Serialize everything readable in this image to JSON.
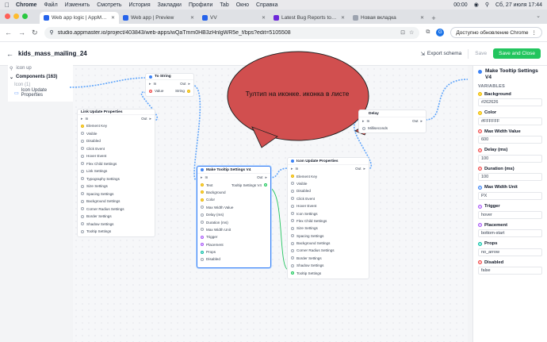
{
  "menubar": {
    "app": "Chrome",
    "items": [
      "Файл",
      "Изменить",
      "Смотреть",
      "История",
      "Закладки",
      "Профили",
      "Tab",
      "Окно",
      "Справка"
    ],
    "time_counter": "00:00",
    "datetime": "Сб, 27 июля 17:44"
  },
  "tabs": [
    {
      "label": "Web app logic | AppMaster",
      "color": "#2563eb"
    },
    {
      "label": "Web app | Preview",
      "color": "#2563eb"
    },
    {
      "label": "VV",
      "color": "#2563eb"
    },
    {
      "label": "Latest Bug Reports topics - A",
      "color": "#6d28d9"
    },
    {
      "label": "Новая вкладка",
      "color": "#9ca3af"
    }
  ],
  "addressbar": {
    "url": "studio.appmaster.io/project/403843/web-apps/wQaTmm0HB3zHnlgWR5e_f/bps?edit=5105508",
    "profile_letter": "G",
    "update_label": "Доступно обновление Chrome"
  },
  "header": {
    "title": "kids_mass_mailing_24",
    "export_label": "Export schema",
    "save_label": "Save",
    "save_close_label": "Save and Close"
  },
  "leftpanel": {
    "search_value": "icon up",
    "components_label": "Components (163)",
    "icon_count": "Icon (1)",
    "item_label": "Icon Update Properties"
  },
  "nodes": {
    "to_string": {
      "title": "To String",
      "in": "In",
      "out": "Out",
      "value": "Value",
      "string": "String"
    },
    "link_update": {
      "title": "Link Update Properties",
      "in": "In",
      "out": "Out",
      "rows": [
        "Element Key",
        "Visible",
        "Disabled",
        "Click Event",
        "Hover Event",
        "Flex Child Settings",
        "Link Settings",
        "Typography Settings",
        "Size Settings",
        "Spacing Settings",
        "Background Settings",
        "Corner Radius Settings",
        "Border Settings",
        "Shadow Settings",
        "Tooltip Settings"
      ]
    },
    "tooltip": {
      "title": "Make Tooltip Settings V4",
      "in": "In",
      "out": "Out",
      "text": "Text",
      "tooltip_out": "Tooltip Settings V4",
      "rows": [
        "Background",
        "Color",
        "Max Width Value",
        "Delay (ms)",
        "Duration (ms)",
        "Max Width Unit",
        "Trigger",
        "Placement",
        "Props",
        "Disabled"
      ]
    },
    "delay": {
      "title": "Delay",
      "in": "In",
      "out": "Out",
      "ms": "Milliseconds"
    },
    "icon_update": {
      "title": "Icon Update Properties",
      "in": "In",
      "out": "Out",
      "rows": [
        "Element Key",
        "Visible",
        "Disabled",
        "Click Event",
        "Hover Event",
        "Icon Settings",
        "Flex Child Settings",
        "Size Settings",
        "Spacing Settings",
        "Background Settings",
        "Corner Radius Settings",
        "Border Settings",
        "Shadow Settings",
        "Tooltip Settings"
      ]
    }
  },
  "callout": {
    "text": "Тултип на иконке. иконка в листе"
  },
  "rightpanel": {
    "title": "Make Tooltip Settings V4",
    "section": "VARIABLES",
    "vars": [
      {
        "label": "Background",
        "value": "#262626"
      },
      {
        "label": "Color",
        "value": "#FFFFFF"
      },
      {
        "label": "Max Width Value",
        "value": "600"
      },
      {
        "label": "Delay (ms)",
        "value": "100"
      },
      {
        "label": "Duration (ms)",
        "value": "100"
      },
      {
        "label": "Max Width Unit",
        "value": "PX"
      },
      {
        "label": "Trigger",
        "value": "hover"
      },
      {
        "label": "Placement",
        "value": "bottom-start"
      },
      {
        "label": "Props",
        "value": "no_arrow"
      },
      {
        "label": "Disabled",
        "value": "false"
      }
    ]
  },
  "colors": {
    "accent": "#3b82f6",
    "save_green": "#22c55e",
    "callout_fill": "#d14f4f",
    "wire": "#60a5fa"
  }
}
